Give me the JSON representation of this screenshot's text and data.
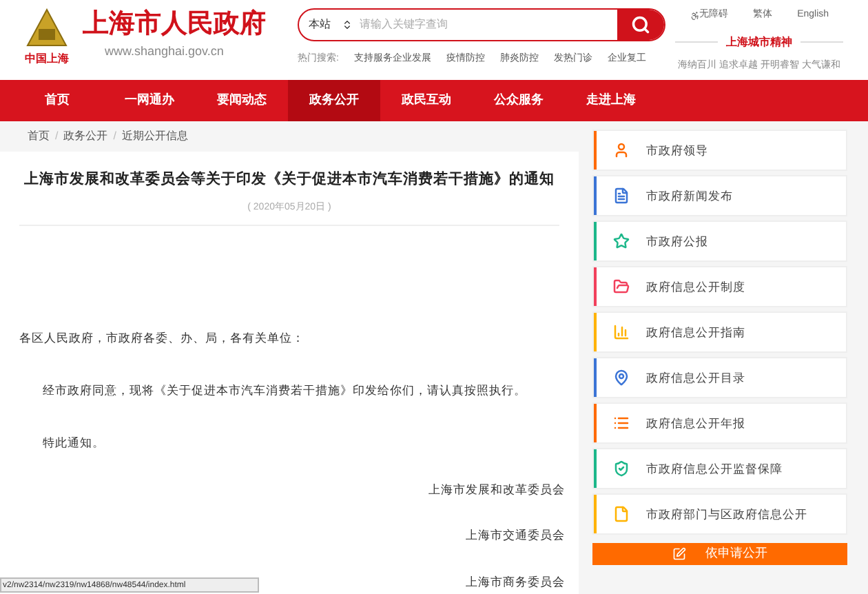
{
  "logo": {
    "title": "上海市人民政府",
    "url": "www.shanghai.gov.cn",
    "badge_caption": "中国上海"
  },
  "search": {
    "scope": "本站",
    "placeholder": "请输入关键字查询",
    "hot_label": "热门搜索:",
    "hot_terms": [
      "支持服务企业发展",
      "疫情防控",
      "肺炎防控",
      "发热门诊",
      "企业复工"
    ]
  },
  "top_links": [
    "无障碍",
    "繁体",
    "English"
  ],
  "city_spirit": {
    "title": "上海城市精神",
    "motto": "海纳百川 追求卓越 开明睿智 大气谦和"
  },
  "nav": [
    {
      "label": "首页",
      "selected": false
    },
    {
      "label": "一网通办",
      "selected": false
    },
    {
      "label": "要闻动态",
      "selected": false
    },
    {
      "label": "政务公开",
      "selected": true
    },
    {
      "label": "政民互动",
      "selected": false
    },
    {
      "label": "公众服务",
      "selected": false
    },
    {
      "label": "走进上海",
      "selected": false
    }
  ],
  "breadcrumb": [
    "首页",
    "政务公开",
    "近期公开信息"
  ],
  "breadcrumb_separator": "/",
  "article": {
    "title": "上海市发展和改革委员会等关于印发《关于促进本市汽车消费若干措施》的通知",
    "date": "( 2020年05月20日 )",
    "salutation": "各区人民政府，市政府各委、办、局，各有关单位：",
    "paragraphs": [
      "经市政府同意，现将《关于促进本市汽车消费若干措施》印发给你们，请认真按照执行。",
      "特此通知。"
    ],
    "signatures": [
      "上海市发展和改革委员会",
      "上海市交通委员会",
      "上海市商务委员会"
    ]
  },
  "sidebar": {
    "items": [
      {
        "label": "市政府领导",
        "kind": "user",
        "color": "#ff6a00"
      },
      {
        "label": "市政府新闻发布",
        "kind": "document",
        "color": "#3b74d6"
      },
      {
        "label": "市政府公报",
        "kind": "star",
        "color": "#1cb78a"
      },
      {
        "label": "政府信息公开制度",
        "kind": "folder",
        "color": "#f2405c"
      },
      {
        "label": "政府信息公开指南",
        "kind": "chart",
        "color": "#ffb300"
      },
      {
        "label": "政府信息公开目录",
        "kind": "pin",
        "color": "#3b74d6"
      },
      {
        "label": "政府信息公开年报",
        "kind": "list",
        "color": "#ff6a00"
      },
      {
        "label": "市政府信息公开监督保障",
        "kind": "shield",
        "color": "#1cb78a"
      },
      {
        "label": "市政府部门与区政府信息公开",
        "kind": "file",
        "color": "#ffb300"
      }
    ],
    "apply_button": "依申请公开"
  },
  "status_url": "v2/nw2314/nw2319/nw14868/nw48544/index.html"
}
